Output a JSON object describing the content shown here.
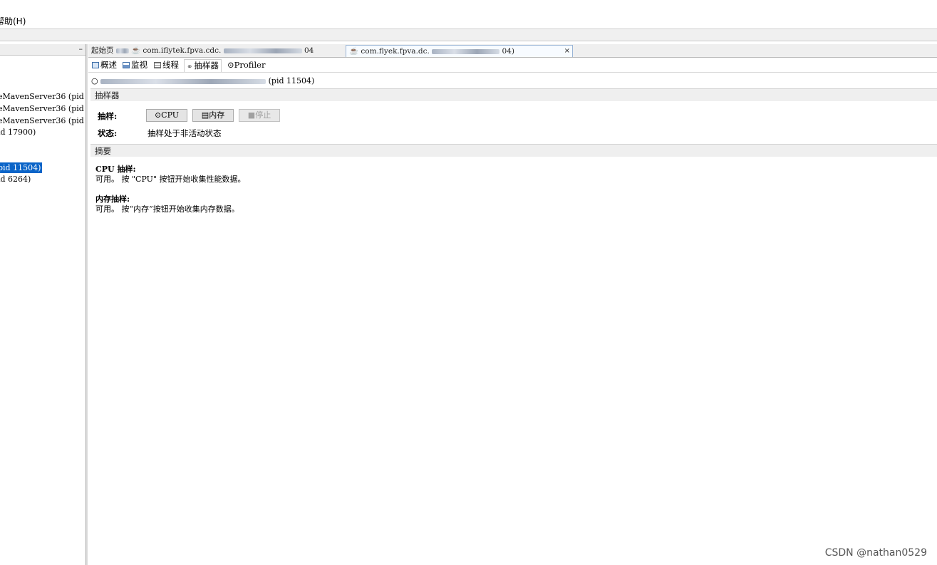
{
  "menu": {
    "help": "帮助(H)"
  },
  "left_tree": {
    "items": [
      {
        "label": "eMavenServer36 (pid"
      },
      {
        "label": "eMavenServer36 (pid"
      },
      {
        "label": "eMavenServer36 (pid"
      },
      {
        "label": "id 17900)"
      },
      {
        "label": "pid 11504)"
      },
      {
        "label": "id 6264)"
      }
    ]
  },
  "doc_tabs": {
    "start_page": "起始页",
    "tab2_label": "com.iflytek.fpva.cdc.",
    "tab2_suffix": "04",
    "tab3_prefix": "com.flyek.fpva.dc.",
    "tab3_suffix": "04)",
    "close": "×"
  },
  "sub_tabs": {
    "overview": "概述",
    "monitor": "监视",
    "threads": "线程",
    "sampler": "抽样器",
    "profiler": "Profiler"
  },
  "process": {
    "pid_text": "(pid 11504)"
  },
  "sampler_section": {
    "title": "抽样器",
    "sampling_label": "抽样:",
    "status_label": "状态:",
    "cpu_button": "CPU",
    "memory_button": "内存",
    "stop_button": "停止",
    "status_value": "抽样处于非活动状态"
  },
  "summary_section": {
    "title": "摘要",
    "cpu_title": "CPU 抽样:",
    "cpu_text": "可用。 按 \"CPU\" 按钮开始收集性能数据。",
    "mem_title": "内存抽样:",
    "mem_text": "可用。 按“内存”按钮开始收集内存数据。"
  },
  "watermark": "CSDN @nathan0529",
  "colors": {
    "selection": "#0a64c8",
    "section_bar": "#efefef",
    "button": "#e4e4e4"
  }
}
